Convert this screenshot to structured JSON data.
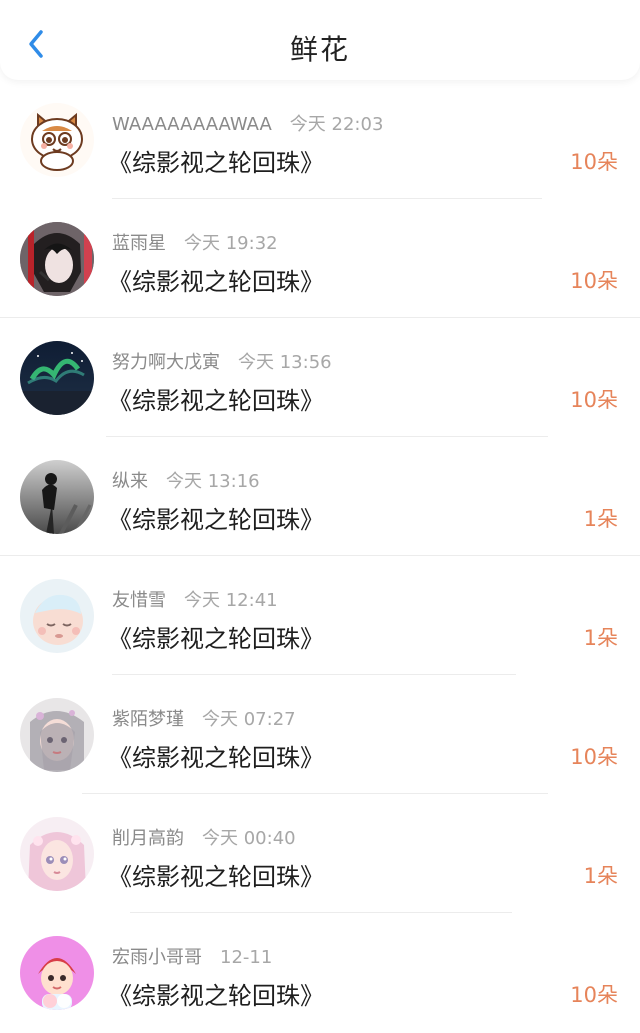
{
  "header": {
    "title": "鲜花"
  },
  "items": [
    {
      "user": "WAAAAAAAAWAA",
      "time": "今天 22:03",
      "book": "《综影视之轮回珠》",
      "count": "10朵",
      "avatar": "cat-avatar"
    },
    {
      "user": "蓝雨星",
      "time": "今天 19:32",
      "book": "《综影视之轮回珠》",
      "count": "10朵",
      "avatar": "anime-boy-avatar"
    },
    {
      "user": "努力啊大戊寅",
      "time": "今天 13:56",
      "book": "《综影视之轮回珠》",
      "count": "10朵",
      "avatar": "aurora-avatar"
    },
    {
      "user": "纵来",
      "time": "今天 13:16",
      "book": "《综影视之轮回珠》",
      "count": "1朵",
      "avatar": "silhouette-avatar"
    },
    {
      "user": "友惜雪",
      "time": "今天 12:41",
      "book": "《综影视之轮回珠》",
      "count": "1朵",
      "avatar": "sleeping-face-avatar"
    },
    {
      "user": "紫陌梦瑾",
      "time": "今天 07:27",
      "book": "《综影视之轮回珠》",
      "count": "10朵",
      "avatar": "anime-girl-avatar"
    },
    {
      "user": "削月高韵",
      "time": "今天 00:40",
      "book": "《综影视之轮回珠》",
      "count": "1朵",
      "avatar": "pink-anime-girl-avatar"
    },
    {
      "user": "宏雨小哥哥",
      "time": "12-11",
      "book": "《综影视之轮回珠》",
      "count": "10朵",
      "avatar": "cartoon-boy-avatar"
    }
  ]
}
